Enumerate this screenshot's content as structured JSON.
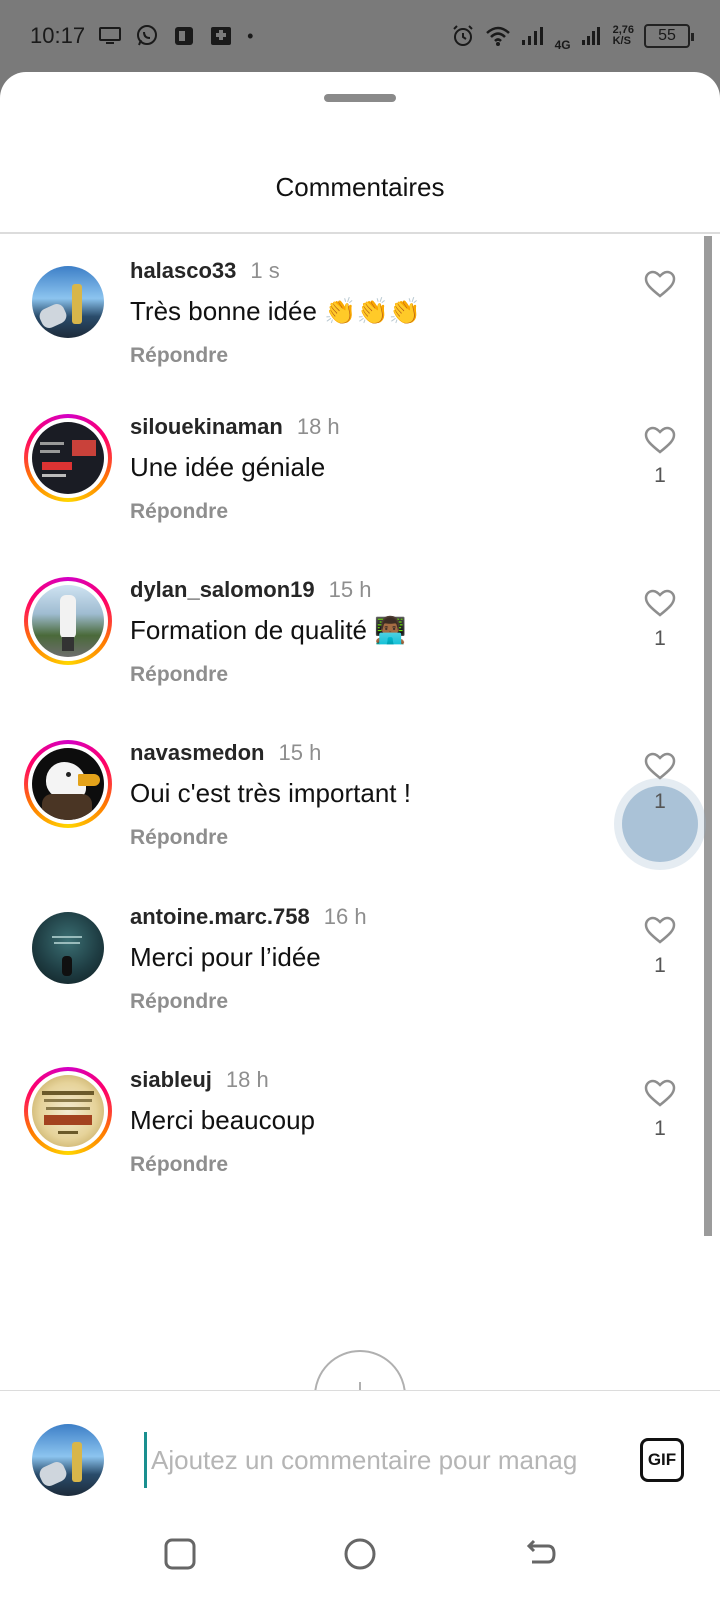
{
  "status_bar": {
    "time": "10:17",
    "left_icons": [
      "screen-icon",
      "whatsapp-icon",
      "news-icon",
      "medical-icon"
    ],
    "dot": "•",
    "net_type": "4G",
    "speed_value": "2,76",
    "speed_unit": "K/S",
    "battery": "55"
  },
  "sheet": {
    "title": "Commentaires"
  },
  "comments": [
    {
      "user": "halasco33",
      "time": "1 s",
      "text": "Très bonne idée 👏👏👏",
      "reply": "Répondre",
      "likes": "",
      "ring": false
    },
    {
      "user": "silouekinaman",
      "time": "18 h",
      "text": "Une idée géniale",
      "reply": "Répondre",
      "likes": "1",
      "ring": true
    },
    {
      "user": "dylan_salomon19",
      "time": "15 h",
      "text": "Formation de qualité 👨🏾‍💻",
      "reply": "Répondre",
      "likes": "1",
      "ring": true
    },
    {
      "user": "navasmedon",
      "time": "15 h",
      "text": "Oui c'est très important !",
      "reply": "Répondre",
      "likes": "1",
      "ring": true
    },
    {
      "user": "antoine.marc.758",
      "time": "16 h",
      "text": "Merci pour l’idée",
      "reply": "Répondre",
      "likes": "1",
      "ring": false
    },
    {
      "user": "siableuj",
      "time": "18 h",
      "text": "Merci beaucoup",
      "reply": "Répondre",
      "likes": "1",
      "ring": true
    }
  ],
  "emoji_bar": [
    "❤️",
    "🙌",
    "🔥",
    "👏",
    "😢",
    "😍",
    "😮",
    "😂"
  ],
  "composer": {
    "placeholder": "Ajoutez un commentaire pour manag",
    "gif_label": "GIF"
  },
  "nav": [
    "recent-apps-icon",
    "home-icon",
    "back-icon"
  ],
  "colors": {
    "status_bg": "#7a7a7a",
    "ring_start": "#d300c5",
    "ring_end": "#ffd600",
    "secondary_text": "#8e8e8e"
  }
}
